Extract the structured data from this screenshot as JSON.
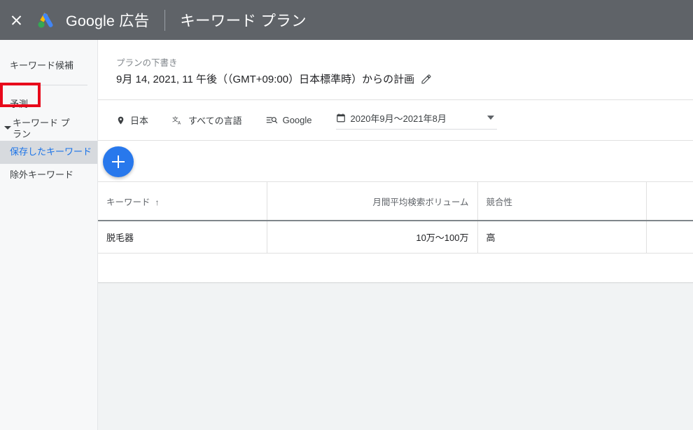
{
  "topbar": {
    "close_label": "close-icon",
    "logo_label": "google-ads-logo",
    "brand": "Google 広告",
    "page_title": "キーワード プラン"
  },
  "sidebar": {
    "items": [
      {
        "label": "キーワード候補",
        "selected": false
      },
      {
        "label": "予測",
        "selected": false,
        "annotated": true
      },
      {
        "label": "キーワード プラン",
        "selected": false,
        "expandable": true
      },
      {
        "label": "保存したキーワード",
        "selected": true
      },
      {
        "label": "除外キーワード",
        "selected": false
      }
    ],
    "annotation_color": "#e8091b",
    "selected_color": "#1a73e8",
    "selected_bg": "#d7dade"
  },
  "plan": {
    "draft_label": "プランの下書き",
    "date_text": "9月 14, 2021, 11 午後（（GMT+09:00）日本標準時）からの計画",
    "edit_icon": "pencil-icon"
  },
  "filters": {
    "location": {
      "icon": "location-pin-icon",
      "label": "日本"
    },
    "language": {
      "icon": "translate-icon",
      "label": "すべての言語"
    },
    "network": {
      "icon": "search-network-icon",
      "label": "Google"
    },
    "daterange": {
      "icon": "calendar-icon",
      "label": "2020年9月〜2021年8月",
      "arrow": "chevron-down-icon"
    }
  },
  "add_button": {
    "icon": "plus-icon",
    "color": "#2878ec"
  },
  "table": {
    "columns": [
      {
        "key": "keyword",
        "label": "キーワード",
        "sort": "↑",
        "align": "left"
      },
      {
        "key": "volume",
        "label": "月間平均検索ボリューム",
        "align": "right"
      },
      {
        "key": "competition",
        "label": "競合性",
        "align": "left"
      },
      {
        "key": "extra",
        "label": "",
        "align": "left"
      }
    ],
    "rows": [
      {
        "keyword": "脱毛器",
        "volume": "10万〜100万",
        "competition": "高",
        "extra": ""
      }
    ]
  },
  "colors": {
    "topbar_bg": "#5f6368",
    "page_bg": "#f1f3f4",
    "sidebar_bg": "#f7f8f9"
  }
}
